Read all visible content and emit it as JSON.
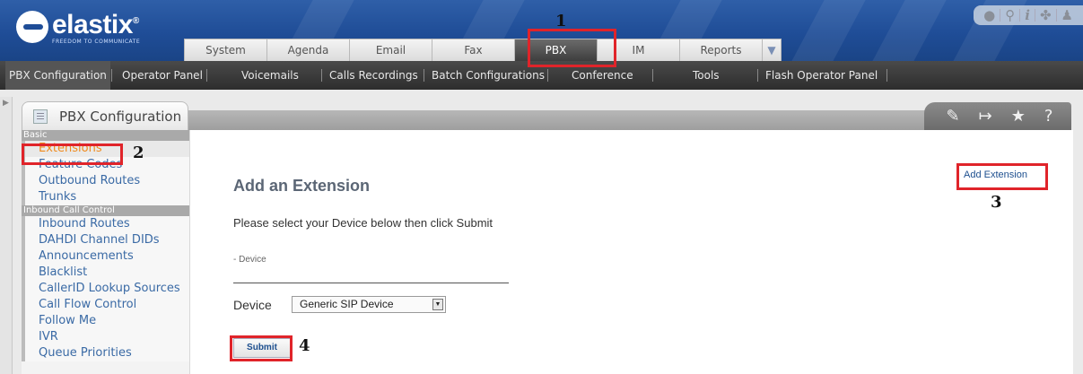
{
  "header": {
    "logo_name": "elastix",
    "logo_tagline": "FREEDOM TO COMMUNICATE",
    "tabs": [
      "System",
      "Agenda",
      "Email",
      "Fax",
      "PBX",
      "IM",
      "Reports"
    ],
    "active_tab": "PBX",
    "more_icon": "chevron-down-icon",
    "top_icons": [
      "drop-icon",
      "search-icon",
      "info-icon",
      "puzzle-icon",
      "user-icon"
    ]
  },
  "submenu": {
    "items": [
      "PBX Configuration",
      "Operator Panel",
      "Voicemails",
      "Calls Recordings",
      "Batch Configurations",
      "Conference",
      "Tools",
      "Flash Operator Panel"
    ],
    "active": "PBX Configuration"
  },
  "module": {
    "title": "PBX Configuration",
    "tools": [
      "edit-icon",
      "pin-icon",
      "star-icon",
      "help-icon"
    ],
    "help_glyph": "?"
  },
  "sidebar": {
    "sections": [
      {
        "title": "Basic",
        "items": [
          "Extensions",
          "Feature Codes",
          "Outbound Routes",
          "Trunks"
        ]
      },
      {
        "title": "Inbound Call Control",
        "items": [
          "Inbound Routes",
          "DAHDI Channel DIDs",
          "Announcements",
          "Blacklist",
          "CallerID Lookup Sources",
          "Call Flow Control",
          "Follow Me",
          "IVR",
          "Queue Priorities"
        ]
      }
    ],
    "selected": "Extensions"
  },
  "content": {
    "title": "Add an Extension",
    "instruction": "Please select your Device below then click Submit",
    "section_label": "- Device",
    "device_label": "Device",
    "device_value": "Generic SIP Device",
    "submit_label": "Submit",
    "add_extension_link": "Add Extension"
  },
  "annotations": {
    "color": "#e0242a",
    "labels": [
      "1",
      "2",
      "3",
      "4"
    ]
  }
}
